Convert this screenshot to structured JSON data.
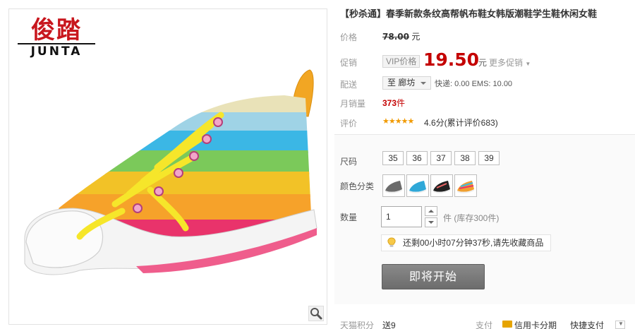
{
  "brand": {
    "name_cn": "俊踏",
    "name_en": "JUNTA"
  },
  "product": {
    "title": "【秒杀通】春季新款条纹高帮帆布鞋女韩版潮鞋学生鞋休闲女鞋"
  },
  "price": {
    "label": "价格",
    "original": "78.00",
    "currency": "元"
  },
  "promo": {
    "label": "促销",
    "badge": "VIP价格",
    "price": "19.50",
    "currency": "元",
    "more": "更多促销"
  },
  "shipping": {
    "label": "配送",
    "destination": "至 廊坊",
    "info": "快递: 0.00 EMS: 10.00"
  },
  "sales": {
    "label": "月销量",
    "count": "373",
    "unit": "件"
  },
  "rating": {
    "label": "评价",
    "stars": 4.6,
    "stars_glyph": "★★★★★",
    "text": "4.6分(累计评价683)"
  },
  "sizes": {
    "label": "尺码",
    "options": [
      "35",
      "36",
      "37",
      "38",
      "39"
    ]
  },
  "colors": {
    "label": "颜色分类",
    "options": [
      {
        "name": "gray-shoe",
        "swatch": "#6b6b6b"
      },
      {
        "name": "blue-shoe",
        "swatch": "#2fa8d8"
      },
      {
        "name": "black-shoe",
        "swatch": "#222222"
      },
      {
        "name": "rainbow-shoe",
        "swatch": "#f0a030"
      }
    ]
  },
  "quantity": {
    "label": "数量",
    "value": "1",
    "stock": "件 (库存300件)"
  },
  "timer": {
    "text": "还剩00小时07分钟37秒,请先收藏商品"
  },
  "buy": {
    "label": "即将开始"
  },
  "bottom": {
    "points_label": "天猫积分",
    "points_value": "送9",
    "pay_label": "支付",
    "credit": "信用卡分期",
    "quick_pay": "快捷支付"
  },
  "colors_theme": {
    "price_red": "#c40000",
    "brand_red": "#c8161d",
    "star_orange": "#f19a00",
    "button_gray": "#7a7a7a"
  }
}
